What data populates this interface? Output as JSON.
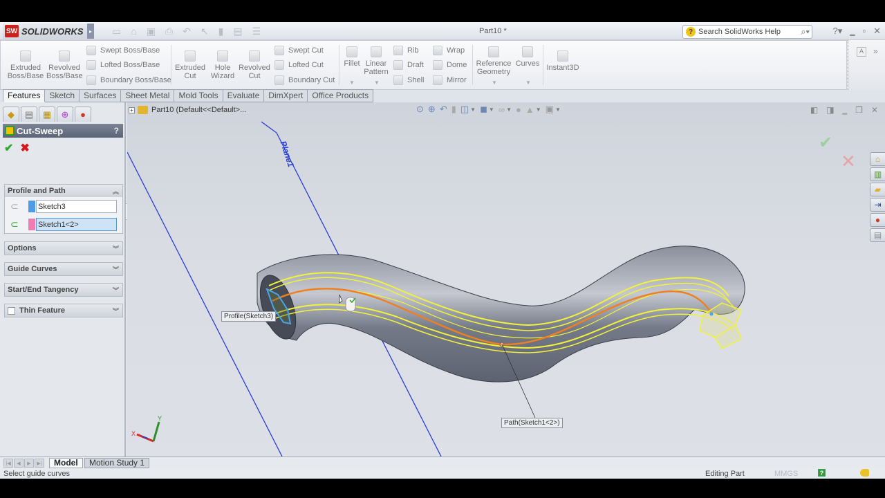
{
  "app": {
    "brand": "SOLIDWORKS",
    "brand_badge": "SW",
    "document_title": "Part10 *",
    "search_placeholder": "Search SolidWorks Help",
    "quick_access": [
      "new-icon",
      "open-icon",
      "save-icon",
      "print-icon",
      "undo-icon",
      "select-icon",
      "rebuild-icon",
      "file-properties-icon",
      "options-icon"
    ]
  },
  "ribbon": {
    "extruded_boss": "Extruded Boss/Base",
    "revolved_boss": "Revolved Boss/Base",
    "swept_boss": "Swept Boss/Base",
    "lofted_boss": "Lofted Boss/Base",
    "boundary_boss": "Boundary Boss/Base",
    "extruded_cut": "Extruded Cut",
    "hole_wizard": "Hole Wizard",
    "revolved_cut": "Revolved Cut",
    "swept_cut": "Swept Cut",
    "lofted_cut": "Lofted Cut",
    "boundary_cut": "Boundary Cut",
    "fillet": "Fillet",
    "linear_pattern": "Linear Pattern",
    "rib": "Rib",
    "draft": "Draft",
    "shell": "Shell",
    "wrap": "Wrap",
    "dome": "Dome",
    "mirror": "Mirror",
    "reference_geometry": "Reference Geometry",
    "curves": "Curves",
    "instant3d": "Instant3D"
  },
  "command_tabs": [
    "Features",
    "Sketch",
    "Surfaces",
    "Sheet Metal",
    "Mold Tools",
    "Evaluate",
    "DimXpert",
    "Office Products"
  ],
  "active_command_tab": "Features",
  "property_manager": {
    "title": "Cut-Sweep",
    "help": "?",
    "ok_symbol": "✔",
    "cancel_symbol": "✖",
    "profile_and_path": {
      "header": "Profile and Path",
      "profile_value": "Sketch3",
      "profile_color": "#4f9be6",
      "path_value": "Sketch1<2>",
      "path_color": "#f07cb0"
    },
    "collapsed_groups": [
      "Options",
      "Guide Curves",
      "Start/End Tangency"
    ],
    "thin_feature": {
      "label": "Thin Feature",
      "checked": false
    }
  },
  "viewport": {
    "tree_root": "Part10  (Default<<Default>...",
    "plane_label": "Plane1",
    "profile_callout": "Profile(Sketch3)",
    "path_callout": "Path(Sketch1<2>)",
    "triad": {
      "x": "X",
      "y": "Y"
    },
    "colors": {
      "background": "#d6dae1",
      "body": "#6b7080",
      "guide": "#f2f23a",
      "path": "#f07f1e",
      "plane": "#2a3dd6",
      "profile": "#47a5e8"
    }
  },
  "bottom_tabs": [
    "Model",
    "Motion Study 1"
  ],
  "active_bottom_tab": "Model",
  "status": {
    "message": "Select guide curves",
    "mode": "Editing Part",
    "units": "MMGS",
    "help": "?"
  }
}
